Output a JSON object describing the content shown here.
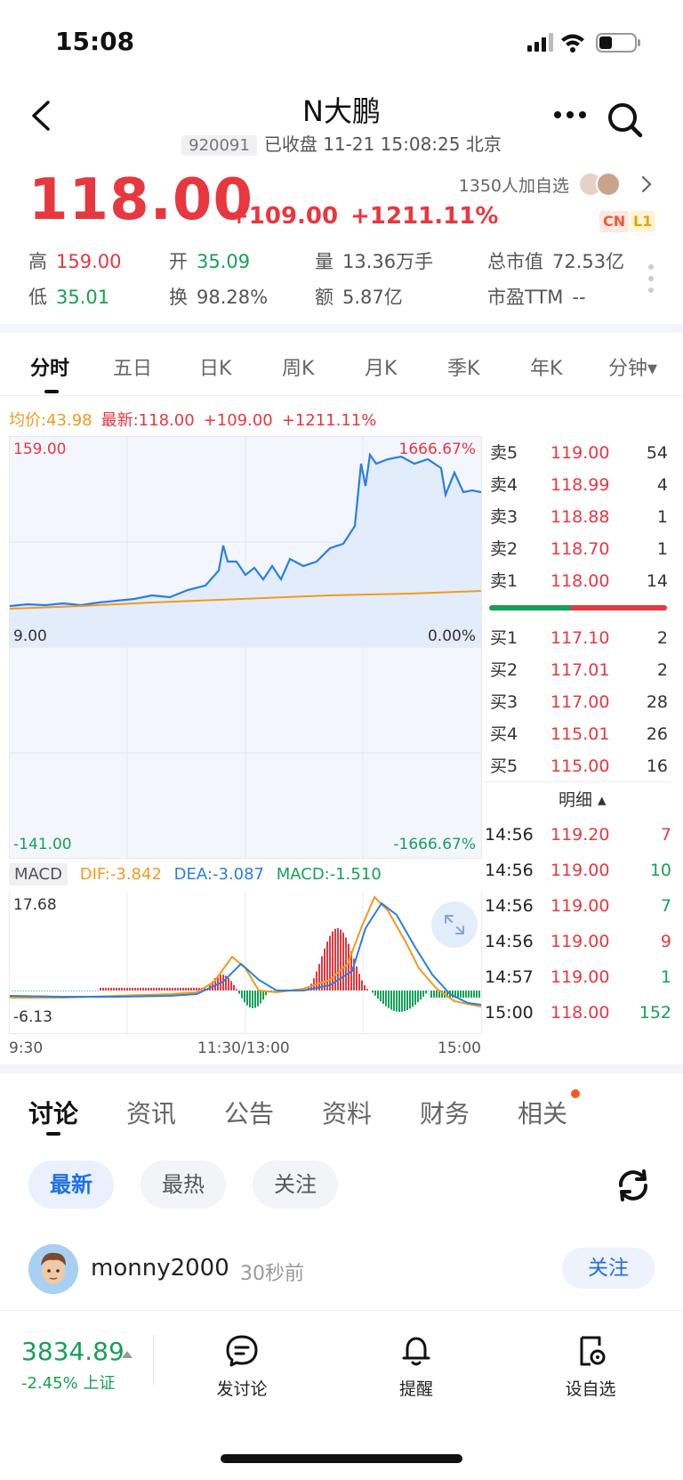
{
  "status_bar": {
    "time": "15:08"
  },
  "header": {
    "title": "N大鹏",
    "code": "920091",
    "status": "已收盘 11-21 15:08:25 北京"
  },
  "quote": {
    "price": "118.00",
    "change": "+109.00",
    "change_pct": "+1211.11%",
    "followers": "1350人加自选",
    "tag_cn": "CN",
    "tag_l1": "L1",
    "high_label": "高",
    "high": "159.00",
    "low_label": "低",
    "low": "35.01",
    "open_label": "开",
    "open": "35.09",
    "turnover_label": "换",
    "turnover": "98.28%",
    "volume_label": "量",
    "volume": "13.36万手",
    "amount_label": "额",
    "amount": "5.87亿",
    "mktcap_label": "总市值",
    "mktcap": "72.53亿",
    "pe_label": "市盈TTM",
    "pe": "--"
  },
  "chart_tabs": [
    "分时",
    "五日",
    "日K",
    "周K",
    "月K",
    "季K",
    "年K",
    "分钟▾"
  ],
  "intraday": {
    "avg": "均价:43.98",
    "latest": "最新:118.00",
    "change": "+109.00",
    "change_pct": "+1211.11%",
    "y_top": "159.00",
    "y_top_pct": "1666.67%",
    "y_mid": "9.00",
    "y_mid_pct": "0.00%",
    "y_bottom": "-141.00",
    "y_bottom_pct": "-1666.67%"
  },
  "macd": {
    "label": "MACD",
    "dif": "DIF:-3.842",
    "dea": "DEA:-3.087",
    "macd": "MACD:-1.510",
    "y_top": "17.68",
    "y_bottom": "-6.13"
  },
  "time_axis": [
    "9:30",
    "11:30/13:00",
    "15:00"
  ],
  "order_book": {
    "asks": [
      {
        "label": "卖5",
        "price": "119.00",
        "vol": "54"
      },
      {
        "label": "卖4",
        "price": "118.99",
        "vol": "4"
      },
      {
        "label": "卖3",
        "price": "118.88",
        "vol": "1"
      },
      {
        "label": "卖2",
        "price": "118.70",
        "vol": "1"
      },
      {
        "label": "卖1",
        "price": "118.00",
        "vol": "14"
      }
    ],
    "buy_ratio": 0.46,
    "bids": [
      {
        "label": "买1",
        "price": "117.10",
        "vol": "2"
      },
      {
        "label": "买2",
        "price": "117.01",
        "vol": "2"
      },
      {
        "label": "买3",
        "price": "117.00",
        "vol": "28"
      },
      {
        "label": "买4",
        "price": "115.01",
        "vol": "26"
      },
      {
        "label": "买5",
        "price": "115.00",
        "vol": "16"
      }
    ],
    "detail_label": "明细 ▴",
    "ticks": [
      {
        "time": "14:56",
        "price": "119.20",
        "vol": "7"
      },
      {
        "time": "14:56",
        "price": "119.00",
        "vol": "10"
      },
      {
        "time": "14:56",
        "price": "119.00",
        "vol": "7"
      },
      {
        "time": "14:56",
        "price": "119.00",
        "vol": "9"
      },
      {
        "time": "14:57",
        "price": "119.00",
        "vol": "1"
      },
      {
        "time": "15:00",
        "price": "118.00",
        "vol": "152"
      }
    ]
  },
  "discussion_tabs": [
    "讨论",
    "资讯",
    "公告",
    "资料",
    "财务",
    "相关"
  ],
  "filters": [
    "最新",
    "最热",
    "关注"
  ],
  "post": {
    "user": "monny2000",
    "time": "30秒前",
    "follow": "关注"
  },
  "bottom_bar": {
    "index_value": "3834.89",
    "index_change": "-2.45%",
    "index_name": "上证",
    "actions": [
      "发讨论",
      "提醒",
      "设自选"
    ]
  },
  "colors": {
    "up": "#e8373e",
    "down": "#16a05a",
    "accent": "#1f6fe8",
    "price_line": "#2a7fe0",
    "avg_line": "#f29a1e"
  }
}
